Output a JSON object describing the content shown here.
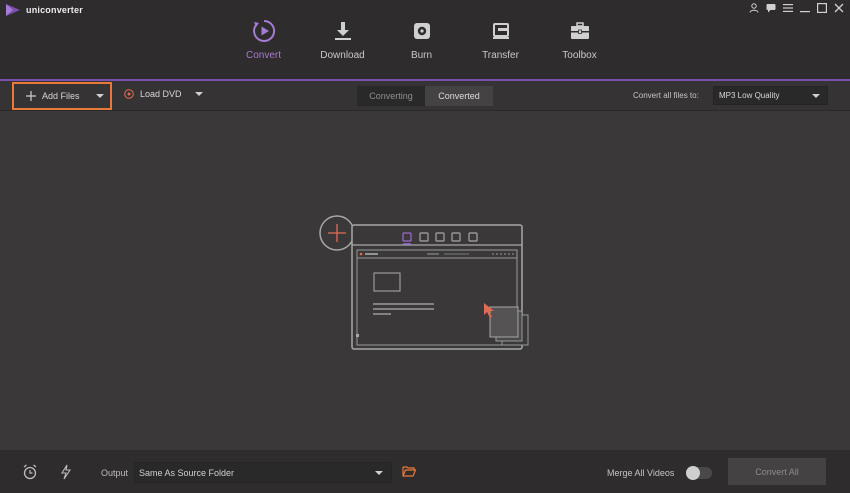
{
  "app": {
    "title": "uniconverter",
    "brand_color": "#8a58c0",
    "accent_color": "#e8793a"
  },
  "window_controls": [
    "user-icon",
    "chat-icon",
    "menu-icon",
    "minimize-icon",
    "maximize-icon",
    "close-icon"
  ],
  "nav": {
    "items": [
      {
        "label": "Convert",
        "icon": "convert-icon",
        "active": true
      },
      {
        "label": "Download",
        "icon": "download-icon"
      },
      {
        "label": "Burn",
        "icon": "burn-icon"
      },
      {
        "label": "Transfer",
        "icon": "transfer-icon"
      },
      {
        "label": "Toolbox",
        "icon": "toolbox-icon"
      }
    ]
  },
  "toolbar": {
    "add_files": "Add Files",
    "load_dvd": "Load DVD",
    "tabs": [
      "Converting",
      "Converted"
    ],
    "convert_all_label": "Convert all files to:",
    "format_value": "MP3 Low Quality"
  },
  "bottom": {
    "output_label": "Output",
    "output_value": "Same As Source Folder",
    "merge_label": "Merge All Videos",
    "convert_all": "Convert All"
  }
}
